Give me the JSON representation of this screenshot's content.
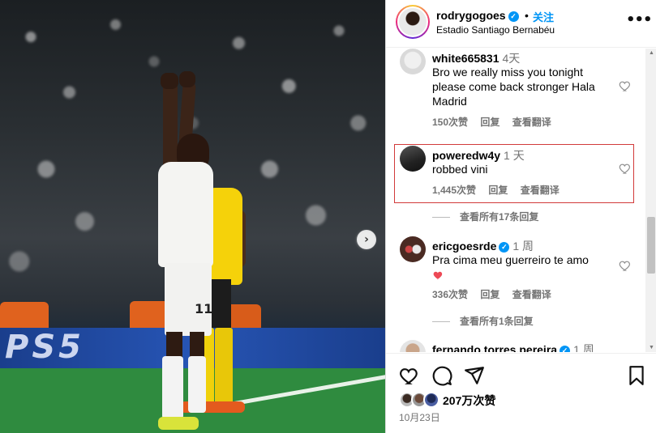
{
  "post": {
    "photo_alt": "",
    "board_text": "PS5",
    "player_number": "11"
  },
  "header": {
    "username": "rodrygogoes",
    "dot": "•",
    "follow_label": "关注",
    "location": "Estadio Santiago Bernabéu"
  },
  "comments": [
    {
      "username": "white665831",
      "time": "4天",
      "text": "Bro we really miss you tonight please come back stronger Hala Madrid",
      "likes": "150次赞",
      "reply": "回复",
      "translate": "查看翻译"
    },
    {
      "username": "poweredw4y",
      "time": "1 天",
      "text": "robbed vini",
      "likes": "1,445次赞",
      "reply": "回复",
      "translate": "查看翻译",
      "view_replies": "查看所有17条回复"
    },
    {
      "username": "ericgoesrde",
      "time": "1 周",
      "text": "Pra cima meu guerreiro te amo",
      "emoji": "❤️",
      "likes": "336次赞",
      "reply": "回复",
      "translate": "查看翻译",
      "view_replies": "查看所有1条回复"
    },
    {
      "username": "fernando.torres.pereira",
      "time": "1 周"
    }
  ],
  "footer": {
    "likes_count": "207万次赞",
    "date": "10月23日"
  },
  "colors": {
    "accent": "#0095f6",
    "highlight_border": "#d23a3a",
    "muted": "#737373",
    "heart_red": "#ed4956"
  }
}
